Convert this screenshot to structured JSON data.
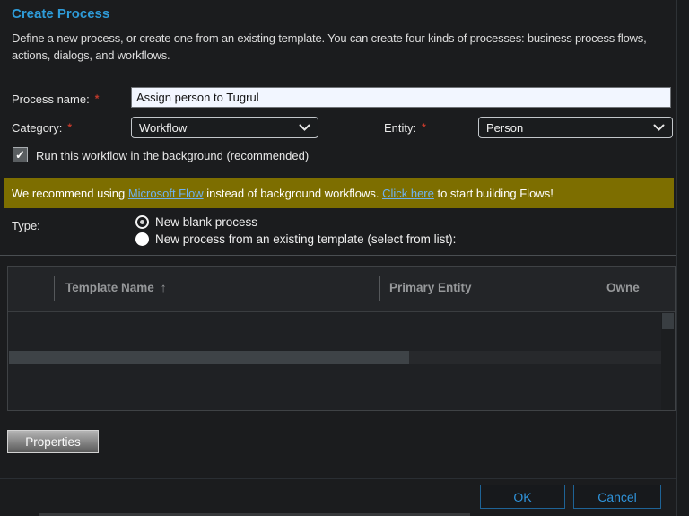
{
  "dialog": {
    "title": "Create Process",
    "description": "Define a new process, or create one from an existing template. You can create four kinds of processes: business process flows, actions, dialogs, and workflows."
  },
  "fields": {
    "process_name": {
      "label": "Process name:",
      "required_marker": "*",
      "value": "Assign person to Tugrul"
    },
    "category": {
      "label": "Category:",
      "required_marker": "*",
      "value": "Workflow"
    },
    "entity": {
      "label": "Entity:",
      "required_marker": "*",
      "value": "Person"
    }
  },
  "background_checkbox": {
    "checked": true,
    "check_glyph": "✓",
    "label": "Run this workflow in the background (recommended)"
  },
  "banner": {
    "text_before": "We recommend using ",
    "link1": "Microsoft Flow",
    "text_middle": " instead of background workflows. ",
    "link2": "Click here",
    "text_after": " to start building Flows!",
    "background_color": "#7D6E00",
    "link_color": "#6FB2F0"
  },
  "type_section": {
    "label": "Type:",
    "options": [
      {
        "label": "New blank process",
        "selected": true
      },
      {
        "label": "New process from an existing template (select from list):",
        "selected": false
      }
    ]
  },
  "template_table": {
    "columns": [
      {
        "label": "Template Name",
        "sort_icon": "↑"
      },
      {
        "label": "Primary Entity",
        "sort_icon": ""
      },
      {
        "label": "Owne",
        "sort_icon": ""
      }
    ],
    "rows": []
  },
  "buttons": {
    "properties": "Properties",
    "ok": "OK",
    "cancel": "Cancel"
  },
  "colors": {
    "accent_blue": "#2E9BD8",
    "required_red": "#C0392B",
    "background": "#1B1C1E",
    "button_border_blue": "#1E6396",
    "button_text_blue": "#2F93DA"
  }
}
